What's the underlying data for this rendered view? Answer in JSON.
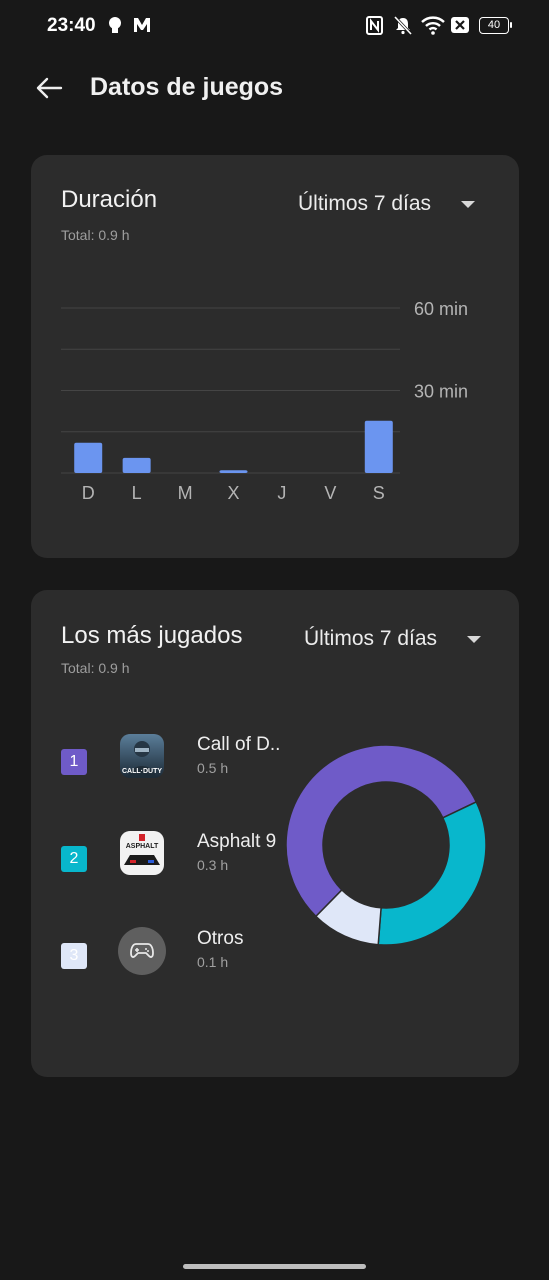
{
  "status_bar": {
    "time": "23:40",
    "battery": "40",
    "icons": [
      "bulb-icon",
      "m-app-icon",
      "nfc-icon",
      "mute-icon",
      "wifi-icon",
      "x-badge-icon",
      "battery-icon"
    ]
  },
  "app_bar": {
    "title": "Datos de juegos",
    "back_icon": "arrow-left-icon"
  },
  "duration_card": {
    "title": "Duración",
    "range": "Últimos 7 días",
    "total": "Total: 0.9 h",
    "chart_data": {
      "type": "bar",
      "categories": [
        "D",
        "L",
        "M",
        "X",
        "J",
        "V",
        "S"
      ],
      "values": [
        11,
        5.5,
        0,
        1,
        0,
        0,
        19
      ],
      "ylim": [
        0,
        60
      ],
      "unit": "min",
      "tick_labels": [
        "60 min",
        "30 min"
      ],
      "grid": true,
      "bar_color": "#6b95f0"
    }
  },
  "most_played_card": {
    "title": "Los más jugados",
    "range": "Últimos 7 días",
    "total": "Total: 0.9 h",
    "games": [
      {
        "rank": "1",
        "name": "Call of D..",
        "time": "0.5 h",
        "color": "#6f5bc8",
        "icon": "call-of-duty-app-icon",
        "icon_caption": "CALL·DUTY"
      },
      {
        "rank": "2",
        "name": "Asphalt 9",
        "time": "0.3 h",
        "color": "#08b7cc",
        "icon": "asphalt-9-app-icon",
        "icon_caption": "ASPHALT"
      },
      {
        "rank": "3",
        "name": "Otros",
        "time": "0.1 h",
        "color": "#dfe7f8",
        "icon": "gamepad-icon"
      }
    ],
    "chart_data": {
      "type": "pie",
      "donut": true,
      "labels": [
        "Call of D..",
        "Asphalt 9",
        "Otros"
      ],
      "values": [
        0.5,
        0.3,
        0.1
      ],
      "colors": [
        "#6f5bc8",
        "#08b7cc",
        "#dfe7f8"
      ]
    }
  }
}
